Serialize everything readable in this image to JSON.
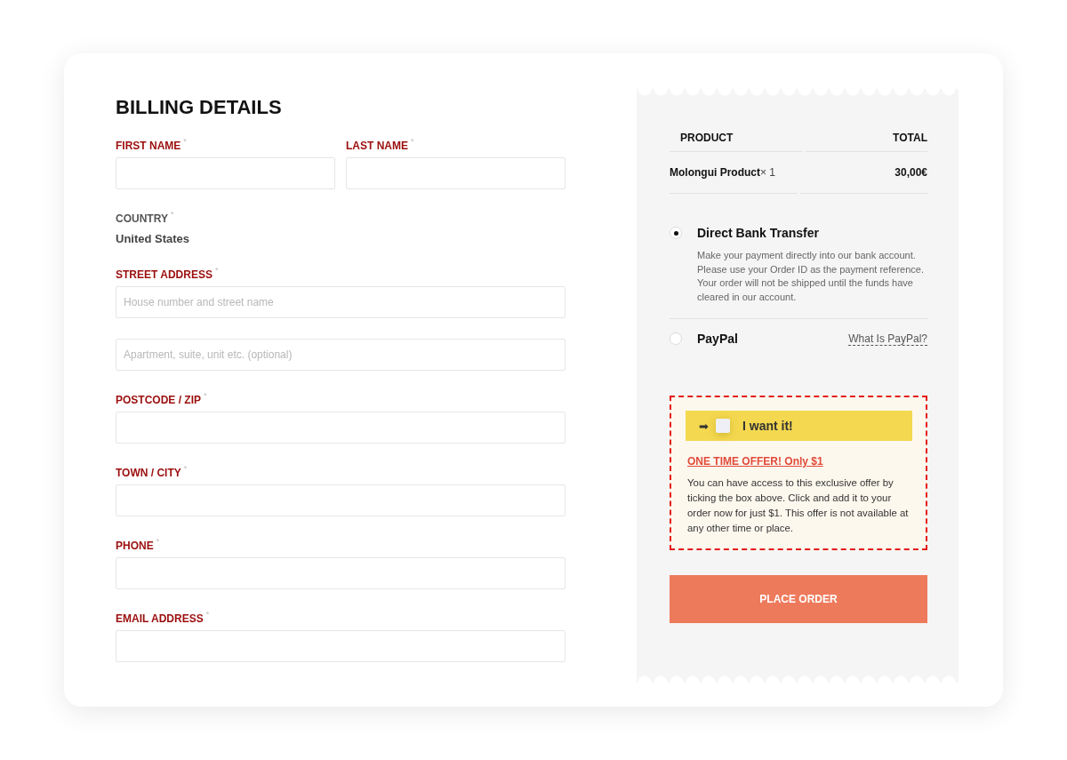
{
  "billing": {
    "title": "BILLING DETAILS",
    "rows": [
      {
        "fields": [
          {
            "kind": "input",
            "label": "FIRST NAME",
            "mark": "*"
          },
          {
            "kind": "input",
            "label": "LAST NAME",
            "mark": "*"
          }
        ]
      },
      {
        "fields": [
          {
            "kind": "static",
            "label": "COUNTRY",
            "mark": "*",
            "value": "United States"
          }
        ]
      },
      {
        "fields": [
          {
            "kind": "input",
            "label": "STREET ADDRESS",
            "mark": "*",
            "placeholder": "House number and street name"
          }
        ]
      },
      {
        "fields": [
          {
            "kind": "input",
            "placeholder": "Apartment, suite, unit etc. (optional)"
          }
        ]
      },
      {
        "fields": [
          {
            "kind": "input",
            "label": "POSTCODE / ZIP",
            "mark": "*"
          }
        ]
      },
      {
        "fields": [
          {
            "kind": "input",
            "label": "TOWN / CITY",
            "mark": "*"
          }
        ]
      },
      {
        "fields": [
          {
            "kind": "input",
            "label": "PHONE",
            "mark": "*"
          }
        ]
      },
      {
        "fields": [
          {
            "kind": "input",
            "label": "EMAIL ADDRESS",
            "mark": "*"
          }
        ]
      }
    ]
  },
  "order": {
    "columns": [
      "PRODUCT",
      "TOTAL"
    ],
    "rows": [
      {
        "product": "Molongui Product",
        "quantity": "× 1",
        "total": "30,00€"
      }
    ]
  },
  "payment_methods": [
    {
      "name": "Direct Bank Transfer",
      "selected": true,
      "description": "Make your payment directly into our bank account. Please use your Order ID as the payment reference. Your order will not be shipped until the funds have cleared in our account."
    },
    {
      "name": "PayPal",
      "selected": false,
      "link": "What Is PayPal?"
    }
  ],
  "offer": {
    "arrow": "➡",
    "checked": false,
    "label": "I want it!",
    "headline": "ONE TIME OFFER! Only $1",
    "text": "You can have access to this exclusive offer by ticking the box above. Click and add it to your order now for just $1. This offer is not available at any other time or place."
  },
  "place_order": "PLACE ORDER"
}
